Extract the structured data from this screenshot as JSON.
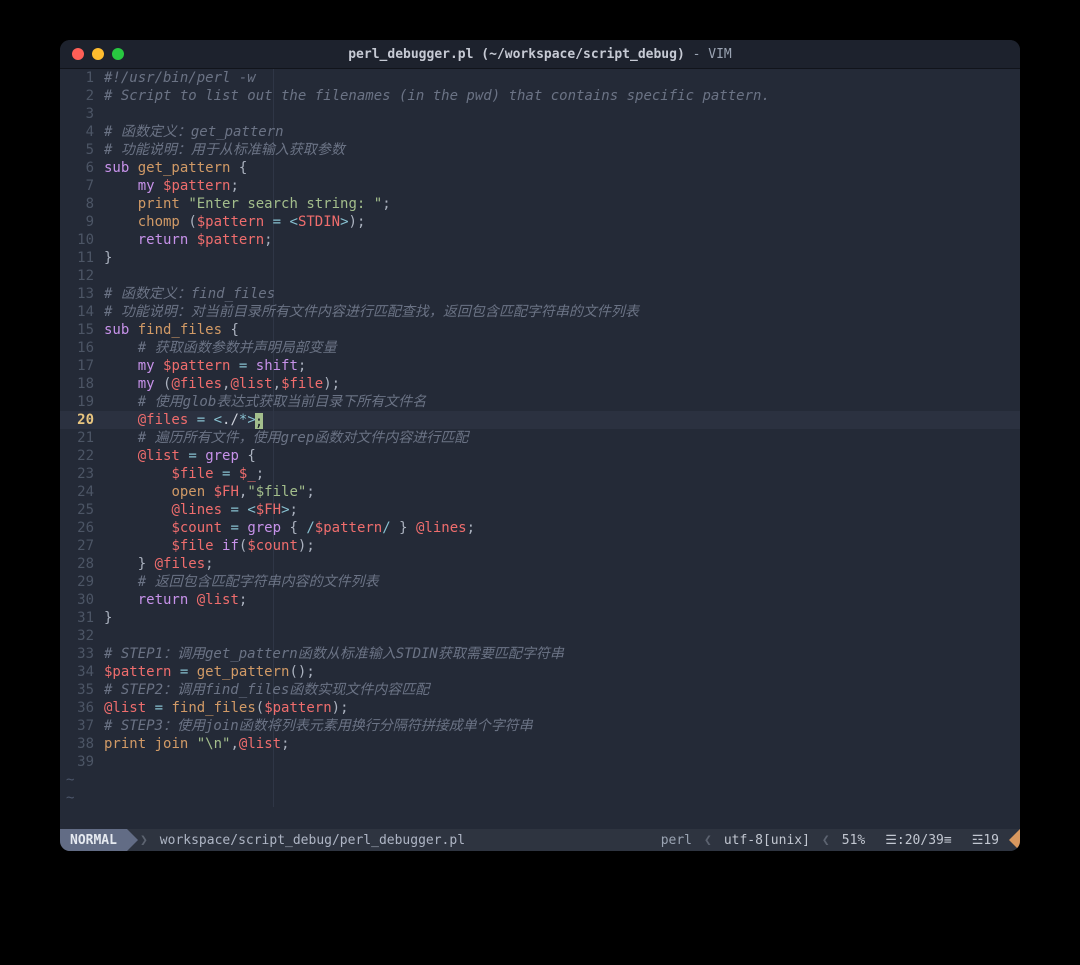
{
  "window": {
    "title_plain": "perl_debugger.pl (~/workspace/script_debug) - VIM",
    "title_bold": "perl_debugger.pl (~/workspace/script_debug)",
    "title_suffix": " - VIM"
  },
  "trafficLights": [
    "close",
    "minimize",
    "zoom"
  ],
  "cursor": {
    "line": 20,
    "col": 21
  },
  "gutter": {
    "current_line_number": "20"
  },
  "lines": [
    {
      "n": 1,
      "tokens": [
        [
          "c",
          "#!/usr/bin/perl -w"
        ]
      ]
    },
    {
      "n": 2,
      "tokens": [
        [
          "c",
          "# Script to list out the filenames (in the pwd) that contains specific pattern."
        ]
      ]
    },
    {
      "n": 3,
      "tokens": []
    },
    {
      "n": 4,
      "tokens": [
        [
          "c",
          "# 函数定义："
        ],
        [
          "ci",
          "get_pattern"
        ]
      ]
    },
    {
      "n": 5,
      "tokens": [
        [
          "c",
          "# 功能说明：用于从标准输入获取参数"
        ]
      ]
    },
    {
      "n": 6,
      "tokens": [
        [
          "k",
          "sub "
        ],
        [
          "fn",
          "get_pattern"
        ],
        [
          "d",
          " "
        ],
        [
          "p",
          "{"
        ]
      ]
    },
    {
      "n": 7,
      "tokens": [
        [
          "d",
          "    "
        ],
        [
          "k",
          "my "
        ],
        [
          "v",
          "$pattern"
        ],
        [
          "p",
          ";"
        ]
      ]
    },
    {
      "n": 8,
      "tokens": [
        [
          "d",
          "    "
        ],
        [
          "fn",
          "print"
        ],
        [
          "d",
          " "
        ],
        [
          "s",
          "\"Enter search string: \""
        ],
        [
          "p",
          ";"
        ]
      ]
    },
    {
      "n": 9,
      "tokens": [
        [
          "d",
          "    "
        ],
        [
          "fn",
          "chomp"
        ],
        [
          "d",
          " "
        ],
        [
          "p",
          "("
        ],
        [
          "v",
          "$pattern"
        ],
        [
          "d",
          " "
        ],
        [
          "o",
          "="
        ],
        [
          "d",
          " "
        ],
        [
          "o",
          "<"
        ],
        [
          "v",
          "STDIN"
        ],
        [
          "o",
          ">"
        ],
        [
          "p",
          ")"
        ],
        [
          "p",
          ";"
        ]
      ]
    },
    {
      "n": 10,
      "tokens": [
        [
          "d",
          "    "
        ],
        [
          "k",
          "return "
        ],
        [
          "v",
          "$pattern"
        ],
        [
          "p",
          ";"
        ]
      ]
    },
    {
      "n": 11,
      "tokens": [
        [
          "p",
          "}"
        ]
      ]
    },
    {
      "n": 12,
      "tokens": []
    },
    {
      "n": 13,
      "tokens": [
        [
          "c",
          "# 函数定义："
        ],
        [
          "ci",
          "find_files"
        ]
      ]
    },
    {
      "n": 14,
      "tokens": [
        [
          "c",
          "# 功能说明：对当前目录所有文件内容进行匹配查找，返回包含匹配字符串的文件列表"
        ]
      ]
    },
    {
      "n": 15,
      "tokens": [
        [
          "k",
          "sub "
        ],
        [
          "fn",
          "find_files"
        ],
        [
          "d",
          " "
        ],
        [
          "p",
          "{"
        ]
      ]
    },
    {
      "n": 16,
      "tokens": [
        [
          "d",
          "    "
        ],
        [
          "c",
          "# 获取函数参数并声明局部变量"
        ]
      ]
    },
    {
      "n": 17,
      "tokens": [
        [
          "d",
          "    "
        ],
        [
          "k",
          "my "
        ],
        [
          "v",
          "$pattern"
        ],
        [
          "d",
          " "
        ],
        [
          "o",
          "="
        ],
        [
          "d",
          " "
        ],
        [
          "k",
          "shift"
        ],
        [
          "p",
          ";"
        ]
      ]
    },
    {
      "n": 18,
      "tokens": [
        [
          "d",
          "    "
        ],
        [
          "k",
          "my "
        ],
        [
          "p",
          "("
        ],
        [
          "v",
          "@files"
        ],
        [
          "p",
          ","
        ],
        [
          "v",
          "@list"
        ],
        [
          "p",
          ","
        ],
        [
          "v",
          "$file"
        ],
        [
          "p",
          ")"
        ],
        [
          "p",
          ";"
        ]
      ]
    },
    {
      "n": 19,
      "tokens": [
        [
          "d",
          "    "
        ],
        [
          "c",
          "# 使用glob表达式获取当前目录下所有文件名"
        ]
      ]
    },
    {
      "n": 20,
      "cur": true,
      "tokens": [
        [
          "d",
          "    "
        ],
        [
          "v",
          "@files"
        ],
        [
          "d",
          " "
        ],
        [
          "o",
          "="
        ],
        [
          "d",
          " "
        ],
        [
          "o",
          "<"
        ],
        [
          "d",
          "./"
        ],
        [
          "o",
          "*>"
        ],
        [
          "cursor",
          ";"
        ]
      ]
    },
    {
      "n": 21,
      "tokens": [
        [
          "d",
          "    "
        ],
        [
          "c",
          "# 遍历所有文件，使用grep函数对文件内容进行匹配"
        ]
      ]
    },
    {
      "n": 22,
      "tokens": [
        [
          "d",
          "    "
        ],
        [
          "v",
          "@list"
        ],
        [
          "d",
          " "
        ],
        [
          "o",
          "="
        ],
        [
          "d",
          " "
        ],
        [
          "k",
          "grep"
        ],
        [
          "d",
          " "
        ],
        [
          "p",
          "{"
        ]
      ]
    },
    {
      "n": 23,
      "tokens": [
        [
          "d",
          "        "
        ],
        [
          "v",
          "$file"
        ],
        [
          "d",
          " "
        ],
        [
          "o",
          "="
        ],
        [
          "d",
          " "
        ],
        [
          "v",
          "$_"
        ],
        [
          "p",
          ";"
        ]
      ]
    },
    {
      "n": 24,
      "tokens": [
        [
          "d",
          "        "
        ],
        [
          "fn",
          "open"
        ],
        [
          "d",
          " "
        ],
        [
          "v",
          "$FH"
        ],
        [
          "p",
          ","
        ],
        [
          "s",
          "\"$file\""
        ],
        [
          "p",
          ";"
        ]
      ]
    },
    {
      "n": 25,
      "tokens": [
        [
          "d",
          "        "
        ],
        [
          "v",
          "@lines"
        ],
        [
          "d",
          " "
        ],
        [
          "o",
          "="
        ],
        [
          "d",
          " "
        ],
        [
          "o",
          "<"
        ],
        [
          "v",
          "$FH"
        ],
        [
          "o",
          ">"
        ],
        [
          "p",
          ";"
        ]
      ]
    },
    {
      "n": 26,
      "tokens": [
        [
          "d",
          "        "
        ],
        [
          "v",
          "$count"
        ],
        [
          "d",
          " "
        ],
        [
          "o",
          "="
        ],
        [
          "d",
          " "
        ],
        [
          "k",
          "grep"
        ],
        [
          "d",
          " "
        ],
        [
          "p",
          "{"
        ],
        [
          "d",
          " "
        ],
        [
          "o",
          "/"
        ],
        [
          "v",
          "$pattern"
        ],
        [
          "o",
          "/"
        ],
        [
          "d",
          " "
        ],
        [
          "p",
          "}"
        ],
        [
          "d",
          " "
        ],
        [
          "v",
          "@lines"
        ],
        [
          "p",
          ";"
        ]
      ]
    },
    {
      "n": 27,
      "tokens": [
        [
          "d",
          "        "
        ],
        [
          "v",
          "$file"
        ],
        [
          "d",
          " "
        ],
        [
          "k",
          "if"
        ],
        [
          "p",
          "("
        ],
        [
          "v",
          "$count"
        ],
        [
          "p",
          ")"
        ],
        [
          "p",
          ";"
        ]
      ]
    },
    {
      "n": 28,
      "tokens": [
        [
          "d",
          "    "
        ],
        [
          "p",
          "}"
        ],
        [
          "d",
          " "
        ],
        [
          "v",
          "@files"
        ],
        [
          "p",
          ";"
        ]
      ]
    },
    {
      "n": 29,
      "tokens": [
        [
          "d",
          "    "
        ],
        [
          "c",
          "# 返回包含匹配字符串内容的文件列表"
        ]
      ]
    },
    {
      "n": 30,
      "tokens": [
        [
          "d",
          "    "
        ],
        [
          "k",
          "return "
        ],
        [
          "v",
          "@list"
        ],
        [
          "p",
          ";"
        ]
      ]
    },
    {
      "n": 31,
      "tokens": [
        [
          "p",
          "}"
        ]
      ]
    },
    {
      "n": 32,
      "tokens": []
    },
    {
      "n": 33,
      "tokens": [
        [
          "c",
          "# STEP1：调用get_pattern函数从标准输入STDIN获取需要匹配字符串"
        ]
      ]
    },
    {
      "n": 34,
      "tokens": [
        [
          "v",
          "$pattern"
        ],
        [
          "d",
          " "
        ],
        [
          "o",
          "="
        ],
        [
          "d",
          " "
        ],
        [
          "fn",
          "get_pattern"
        ],
        [
          "p",
          "()"
        ],
        [
          "p",
          ";"
        ]
      ]
    },
    {
      "n": 35,
      "tokens": [
        [
          "c",
          "# STEP2：调用find_files函数实现文件内容匹配"
        ]
      ]
    },
    {
      "n": 36,
      "tokens": [
        [
          "v",
          "@list"
        ],
        [
          "d",
          " "
        ],
        [
          "o",
          "="
        ],
        [
          "d",
          " "
        ],
        [
          "fn",
          "find_files"
        ],
        [
          "p",
          "("
        ],
        [
          "v",
          "$pattern"
        ],
        [
          "p",
          ")"
        ],
        [
          "p",
          ";"
        ]
      ]
    },
    {
      "n": 37,
      "tokens": [
        [
          "c",
          "# STEP3：使用join函数将列表元素用换行分隔符拼接成单个字符串"
        ]
      ]
    },
    {
      "n": 38,
      "tokens": [
        [
          "fn",
          "print"
        ],
        [
          "d",
          " "
        ],
        [
          "fn",
          "join"
        ],
        [
          "d",
          " "
        ],
        [
          "s",
          "\"\\n\""
        ],
        [
          "p",
          ","
        ],
        [
          "v",
          "@list"
        ],
        [
          "p",
          ";"
        ]
      ]
    },
    {
      "n": 39,
      "tokens": []
    }
  ],
  "tildes": 2,
  "status": {
    "mode": "NORMAL",
    "path": "workspace/script_debug/perl_debugger.pl",
    "filetype": "perl",
    "encoding": "utf-8[unix]",
    "percent": "51%",
    "lineinfo_icon": "☰",
    "lineinfo": ":20/39",
    "trailing_icon": "≡",
    "warn_icon": "☲",
    "warn": "19"
  }
}
